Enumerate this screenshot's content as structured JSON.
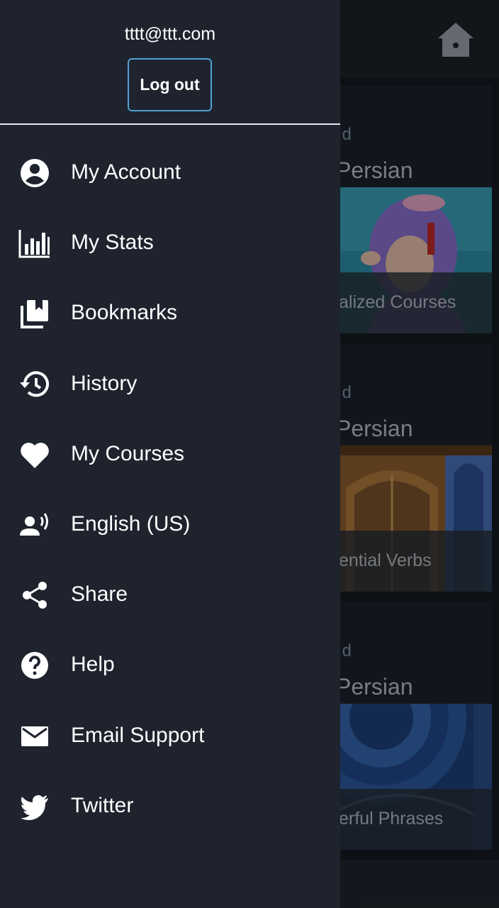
{
  "account": {
    "email": "tttt@ttt.com",
    "logout_label": "Log out"
  },
  "menu": [
    {
      "label": "My Account",
      "icon": "account-circle-icon"
    },
    {
      "label": "My Stats",
      "icon": "bar-chart-icon"
    },
    {
      "label": "Bookmarks",
      "icon": "bookmarks-icon"
    },
    {
      "label": "History",
      "icon": "history-icon"
    },
    {
      "label": "My Courses",
      "icon": "heart-icon"
    },
    {
      "label": "English (US)",
      "icon": "voice-language-icon"
    },
    {
      "label": "Share",
      "icon": "share-icon"
    },
    {
      "label": "Help",
      "icon": "help-icon"
    },
    {
      "label": "Email Support",
      "icon": "mail-icon"
    },
    {
      "label": "Twitter",
      "icon": "twitter-icon"
    }
  ],
  "background": {
    "cards": [
      {
        "tag": "d",
        "language": "Persian",
        "caption": "alized Courses"
      },
      {
        "tag": "d",
        "language": "Persian",
        "caption": "ential Verbs"
      },
      {
        "tag": "d",
        "language": "Persian",
        "caption": "erful Phrases"
      }
    ]
  },
  "colors": {
    "drawer": "#1e232e",
    "accent": "#4fa3d1",
    "text": "#ffffff"
  }
}
